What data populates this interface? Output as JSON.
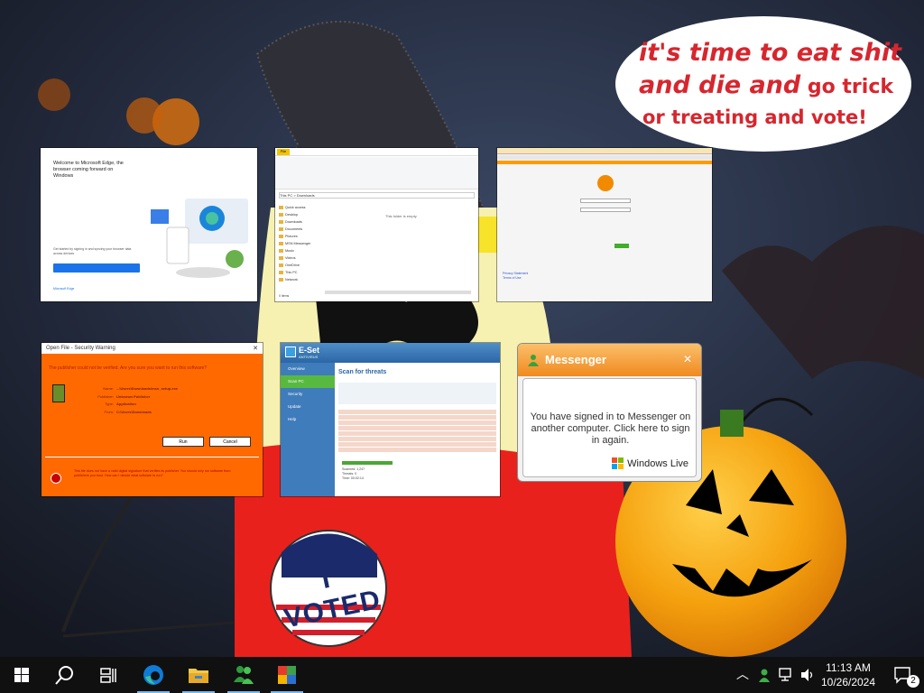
{
  "wallpaper": {
    "bubble_line1": "it's time to eat shit",
    "bubble_line2_big": "and die and",
    "bubble_line2_small": " go trick",
    "bubble_line3": "or treating and vote!",
    "sticker": "I VOTED"
  },
  "edge": {
    "welcome": "Welcome to Microsoft Edge, the browser coming forward on Windows",
    "body": "Get started by signing in and syncing your browser data across devices",
    "footer": "Microsoft Edge"
  },
  "explorer": {
    "file_tab": "File",
    "address": "This PC > Downloads",
    "empty": "This folder is empty.",
    "nav": [
      "Quick access",
      "Desktop",
      "Downloads",
      "Documents",
      "Pictures",
      "MSN Messenger",
      "Music",
      "Videos",
      "OneDrive",
      "This PC",
      "Network"
    ],
    "status": "0 items"
  },
  "messenger_web": {
    "links": "Privacy Statement\nTerms of Use"
  },
  "warning": {
    "title": "Open File - Security Warning",
    "question": "The publisher could not be verified. Are you sure you want to run this software?",
    "fields": [
      {
        "label": "Name:",
        "value": "...\\Users\\Downloads\\msn_setup.exe"
      },
      {
        "label": "Publisher:",
        "value": "Unknown Publisher"
      },
      {
        "label": "Type:",
        "value": "Application"
      },
      {
        "label": "From:",
        "value": "C:\\Users\\Downloads"
      }
    ],
    "run": "Run",
    "cancel": "Cancel",
    "warn_text": "This file does not have a valid digital signature that verifies its publisher. You should only run software from publishers you trust. How can I decide what software to run?"
  },
  "eset": {
    "name": "E-Set",
    "subtitle": "ANTIVIRUS",
    "scan_title": "Scan for threats",
    "nav": [
      "Overview",
      "Scan PC",
      "Security",
      "Update",
      "Help"
    ],
    "stats": "Scanned: 1,247\nThreats: 0\nTime: 00:02:14"
  },
  "messenger_toast": {
    "title": "Messenger",
    "close": "✕",
    "message": "You have signed in to Messenger on another computer. Click here to sign in again.",
    "brand": "Windows Live"
  },
  "taskbar": {
    "time": "11:13 AM",
    "date": "10/26/2024",
    "notification_count": "2"
  }
}
